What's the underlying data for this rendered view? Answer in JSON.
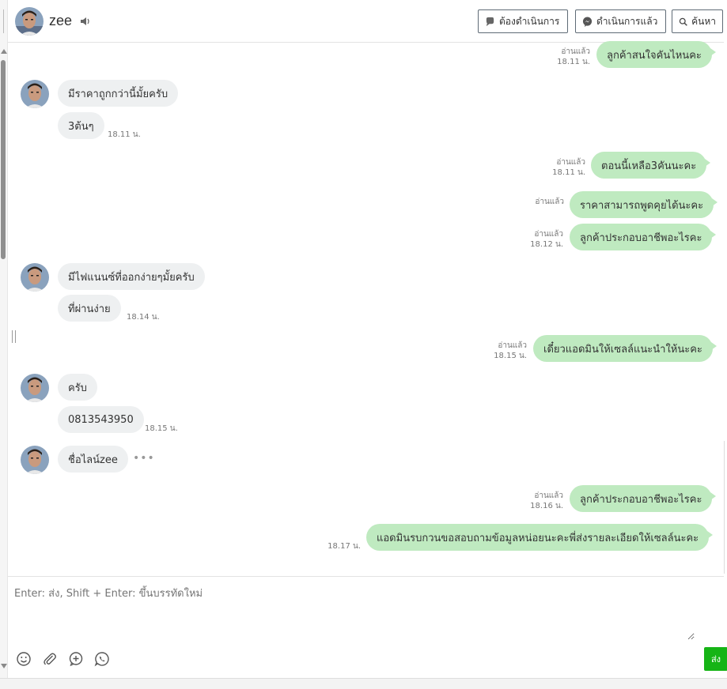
{
  "header": {
    "contact_name": "zee",
    "btn_todo": "ต้องดำเนินการ",
    "btn_done": "ดำเนินการแล้ว",
    "btn_search": "ค้นหา"
  },
  "messages": [
    {
      "dir": "out",
      "text": "ลูกค้าสนใจคันไหนคะ",
      "status": "อ่านแล้ว",
      "time": "18.11 น."
    },
    {
      "dir": "in",
      "text": "มีราคาถูกกว่านี้มั้ยครับ"
    },
    {
      "dir": "in",
      "text": "3ต้นๆ",
      "time": "18.11 น."
    },
    {
      "dir": "out",
      "text": "ตอนนี้เหลือ3คันนะคะ",
      "status": "อ่านแล้ว",
      "time": "18.11 น."
    },
    {
      "dir": "out",
      "text": "ราคาสามารถพูดคุยได้นะคะ",
      "status": "อ่านแล้ว"
    },
    {
      "dir": "out",
      "text": "ลูกค้าประกอบอาชีพอะไรคะ",
      "status": "อ่านแล้ว",
      "time": "18.12 น."
    },
    {
      "dir": "in",
      "text": "มีไฟแนนซ์ที่ออกง่ายๆมั้ยครับ"
    },
    {
      "dir": "in",
      "text": "ที่ผ่านง่าย",
      "time": "18.14 น."
    },
    {
      "dir": "out",
      "text": "เดี๋ยวแอดมินให้เซลล์แนะนำให้นะคะ",
      "status": "อ่านแล้ว",
      "time": "18.15 น."
    },
    {
      "dir": "in",
      "text": "ครับ"
    },
    {
      "dir": "in",
      "text": "0813543950",
      "time": "18.15 น."
    },
    {
      "dir": "in",
      "text": "ชื่อไลน์zee",
      "dots": "•••"
    },
    {
      "dir": "out",
      "text": "ลูกค้าประกอบอาชีพอะไรคะ",
      "status": "อ่านแล้ว",
      "time": "18.16 น."
    },
    {
      "dir": "out",
      "text": "แอดมินรบกวนขอสอบถามข้อมูลหน่อยนะคะพี่ส่งรายละเอียดให้เซลล์นะคะ",
      "time": "18.17 น."
    }
  ],
  "composer": {
    "placeholder": "Enter: ส่ง, Shift + Enter: ขึ้นบรรทัดใหม่",
    "send_label": "ส่ง"
  },
  "icons": {
    "speaker": "speaker-icon",
    "emoji": "smiley-icon",
    "attach": "paperclip-icon",
    "add": "plus-circle-icon",
    "whatsapp": "phone-bubble-icon"
  },
  "colors": {
    "outgoing_bubble": "#bfeac0",
    "incoming_bubble": "#eef0f1",
    "send_button": "#16b416"
  }
}
